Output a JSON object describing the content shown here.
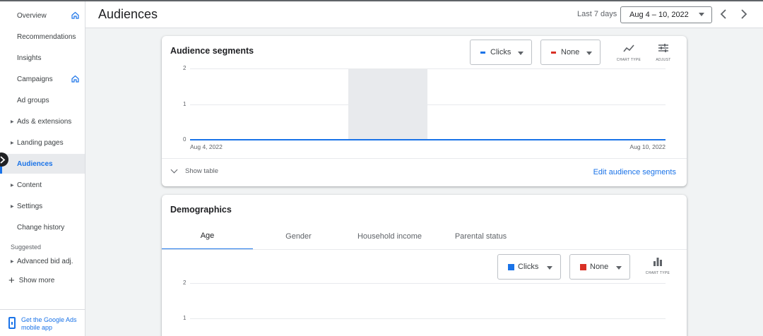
{
  "sidebar": {
    "items": [
      {
        "label": "Overview",
        "has_home": true,
        "caret": false,
        "active": false
      },
      {
        "label": "Recommendations",
        "has_home": false,
        "caret": false,
        "active": false
      },
      {
        "label": "Insights",
        "has_home": false,
        "caret": false,
        "active": false
      },
      {
        "label": "Campaigns",
        "has_home": true,
        "caret": false,
        "active": false
      },
      {
        "label": "Ad groups",
        "has_home": false,
        "caret": false,
        "active": false
      },
      {
        "label": "Ads & extensions",
        "has_home": false,
        "caret": true,
        "active": false
      },
      {
        "label": "Landing pages",
        "has_home": false,
        "caret": true,
        "active": false
      },
      {
        "label": "Audiences",
        "has_home": false,
        "caret": false,
        "active": true
      },
      {
        "label": "Content",
        "has_home": false,
        "caret": true,
        "active": false
      },
      {
        "label": "Settings",
        "has_home": false,
        "caret": true,
        "active": false
      },
      {
        "label": "Change history",
        "has_home": false,
        "caret": false,
        "active": false
      }
    ],
    "suggested_label": "Suggested",
    "suggested_items": [
      {
        "label": "Advanced bid adj.",
        "caret": true
      }
    ],
    "show_more": "Show more",
    "mobile_app": "Get the Google Ads mobile app"
  },
  "header": {
    "title": "Audiences",
    "range_label": "Last 7 days",
    "date_range": "Aug 4 – 10, 2022"
  },
  "segments": {
    "title": "Audience segments",
    "metric1": {
      "label": "Clicks",
      "color": "#1a73e8"
    },
    "metric2": {
      "label": "None",
      "color": "#d93025"
    },
    "chart_type_label": "CHART TYPE",
    "adjust_label": "ADJUST",
    "show_table": "Show table",
    "edit_link": "Edit audience segments"
  },
  "demographics": {
    "title": "Demographics",
    "tabs": [
      "Age",
      "Gender",
      "Household income",
      "Parental status"
    ],
    "active_tab": 0,
    "metric1": {
      "label": "Clicks",
      "color": "#1a73e8"
    },
    "metric2": {
      "label": "None",
      "color": "#d93025"
    },
    "chart_type_label": "CHART TYPE"
  },
  "chart_data": [
    {
      "type": "line",
      "x": [
        "Aug 4, 2022",
        "Aug 5, 2022",
        "Aug 6, 2022",
        "Aug 7, 2022",
        "Aug 8, 2022",
        "Aug 9, 2022",
        "Aug 10, 2022"
      ],
      "x_tick_labels": [
        "Aug 4, 2022",
        "Aug 10, 2022"
      ],
      "series": [
        {
          "name": "Clicks",
          "values": [
            0,
            0,
            0,
            0,
            0,
            0,
            0
          ]
        }
      ],
      "y_ticks": [
        0,
        1,
        2
      ],
      "ylim": [
        0,
        2
      ],
      "highlight_x": [
        "Aug 6, 2022",
        "Aug 7, 2022"
      ],
      "line_color": "#1a73e8"
    },
    {
      "type": "bar",
      "y_ticks": [
        1,
        2
      ],
      "ylim": [
        0,
        2
      ],
      "series": [
        {
          "name": "Clicks",
          "values": []
        }
      ]
    }
  ]
}
